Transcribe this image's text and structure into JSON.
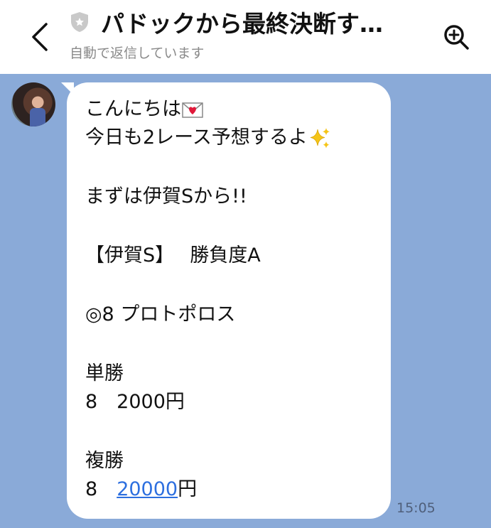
{
  "header": {
    "back_label": "back",
    "title": "パドックから最終決断す…",
    "subtitle": "自動で返信しています"
  },
  "message": {
    "line1": "こんにちは",
    "line2": "今日も2レース予想するよ",
    "line3": "まずは伊賀Sから!!",
    "line4": "【伊賀S】　 勝負度A",
    "line5": "◎8 プロトポロス",
    "line6": "単勝",
    "line7": "8　2000円",
    "line8": "複勝",
    "line9_prefix": "8　",
    "line9_link": "20000",
    "line9_suffix": "円",
    "time": "15:05"
  },
  "icons": {
    "back": "chevron-left-icon",
    "badge": "shield-icon",
    "search": "search-icon",
    "mail": "love-letter-icon",
    "sparkles": "sparkles-icon"
  },
  "colors": {
    "chat_background": "#8aaad8",
    "link": "#2d6fdf"
  }
}
